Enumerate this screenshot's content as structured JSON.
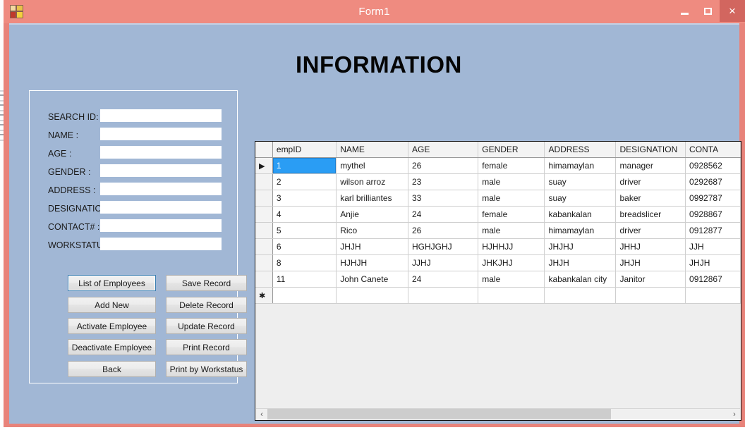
{
  "window": {
    "title": "Form1",
    "icon_name": "vs-form-icon",
    "minimize_label": "Minimize",
    "maximize_label": "Maximize",
    "close_label": "×",
    "frame_color": "#ef8b80",
    "close_bg": "#d2665f",
    "client_bg": "#a1b7d5"
  },
  "page": {
    "title": "INFORMATION"
  },
  "form": {
    "fields": [
      {
        "label": "SEARCH ID:",
        "value": "",
        "placeholder": ""
      },
      {
        "label": "NAME :",
        "value": "",
        "placeholder": ""
      },
      {
        "label": "AGE :",
        "value": "",
        "placeholder": ""
      },
      {
        "label": "GENDER :",
        "value": "",
        "placeholder": ""
      },
      {
        "label": "ADDRESS :",
        "value": "",
        "placeholder": ""
      },
      {
        "label": "DESIGNATION:",
        "value": "",
        "placeholder": ""
      },
      {
        "label": "CONTACT# :",
        "value": "",
        "placeholder": ""
      },
      {
        "label": "WORKSTATUS:",
        "value": "",
        "placeholder": ""
      }
    ],
    "buttons_left": [
      {
        "label": "List of Employees",
        "focused": true
      },
      {
        "label": "Add New",
        "focused": false
      },
      {
        "label": "Activate Employee",
        "focused": false
      },
      {
        "label": "Deactivate Employee",
        "focused": false
      },
      {
        "label": "Back",
        "focused": false
      }
    ],
    "buttons_right": [
      {
        "label": "Save Record",
        "focused": false
      },
      {
        "label": "Delete Record",
        "focused": false
      },
      {
        "label": "Update Record",
        "focused": false
      },
      {
        "label": "Print Record",
        "focused": false
      },
      {
        "label": "Print by Workstatus",
        "focused": false
      }
    ]
  },
  "grid": {
    "columns": [
      "empID",
      "NAME",
      "AGE",
      "GENDER",
      "ADDRESS",
      "DESIGNATION",
      "CONTA"
    ],
    "selected_cell": {
      "row": 0,
      "column": 0
    },
    "current_row_marker": "▶",
    "new_row_marker": "✱",
    "selection_color": "#2a9df4",
    "rows": [
      {
        "marker": "▶",
        "cells": [
          "1",
          "mythel",
          "26",
          "female",
          "himamaylan",
          "manager",
          "0928562"
        ]
      },
      {
        "marker": "",
        "cells": [
          "2",
          "wilson arroz",
          "23",
          "male",
          "suay",
          "driver",
          "0292687"
        ]
      },
      {
        "marker": "",
        "cells": [
          "3",
          "karl brilliantes",
          "33",
          "male",
          "suay",
          "baker",
          "0992787"
        ]
      },
      {
        "marker": "",
        "cells": [
          "4",
          "Anjie",
          "24",
          "female",
          "kabankalan",
          "breadslicer",
          "0928867"
        ]
      },
      {
        "marker": "",
        "cells": [
          "5",
          "Rico",
          "26",
          "male",
          "himamaylan",
          "driver",
          "0912877"
        ]
      },
      {
        "marker": "",
        "cells": [
          "6",
          "JHJH",
          "HGHJGHJ",
          "HJHHJJ",
          "JHJHJ",
          "JHHJ",
          "JJH"
        ]
      },
      {
        "marker": "",
        "cells": [
          "8",
          "HJHJH",
          "JJHJ",
          "JHKJHJ",
          "JHJH",
          "JHJH",
          "JHJH"
        ]
      },
      {
        "marker": "",
        "cells": [
          "11",
          "John Canete",
          "24",
          "male",
          "kabankalan city",
          "Janitor",
          "0912867"
        ]
      }
    ],
    "new_row_cells": [
      "",
      "",
      "",
      "",
      "",
      "",
      ""
    ],
    "scrollbar": {
      "left_arrow": "‹",
      "right_arrow": "›",
      "thumb_percent": 74.5
    }
  }
}
